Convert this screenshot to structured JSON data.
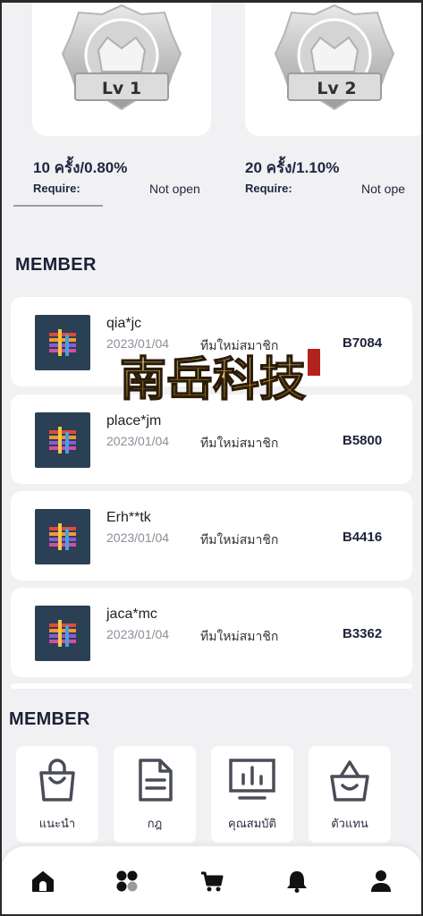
{
  "levels": [
    {
      "badge": "Lv 1",
      "rate": "10 ครั้ง/0.80%",
      "require_label": "Require:",
      "require_value": "Not open"
    },
    {
      "badge": "Lv 2",
      "rate": "20 ครั้ง/1.10%",
      "require_label": "Require:",
      "require_value": "Not ope"
    }
  ],
  "member_section": {
    "title": "MEMBER"
  },
  "members": [
    {
      "name": "qia*jc",
      "date": "2023/01/04",
      "status": "ทีมใหม่สมาชิก",
      "amount": "B7084"
    },
    {
      "name": "place*jm",
      "date": "2023/01/04",
      "status": "ทีมใหม่สมาชิก",
      "amount": "B5800"
    },
    {
      "name": "Erh**tk",
      "date": "2023/01/04",
      "status": "ทีมใหม่สมาชิก",
      "amount": "B4416"
    },
    {
      "name": "jaca*mc",
      "date": "2023/01/04",
      "status": "ทีมใหม่สมาชิก",
      "amount": "B3362"
    }
  ],
  "menu_section": {
    "title": "MEMBER"
  },
  "menu": [
    {
      "label": "แนะนำ",
      "icon": "shopping-bag-icon"
    },
    {
      "label": "กฎ",
      "icon": "document-icon"
    },
    {
      "label": "คุณสมบัติ",
      "icon": "bar-chart-icon"
    },
    {
      "label": "ตัวแทน",
      "icon": "basket-icon"
    }
  ],
  "bottom_nav": [
    {
      "icon": "home-icon"
    },
    {
      "icon": "apps-icon"
    },
    {
      "icon": "cart-icon"
    },
    {
      "icon": "bell-icon"
    },
    {
      "icon": "user-icon"
    }
  ],
  "watermark": {
    "text": "南岳科技"
  },
  "colors": {
    "background": "#f1f1f3",
    "card": "#ffffff",
    "text_dark": "#1c2237",
    "avatar_bg": "#2b3f55"
  }
}
